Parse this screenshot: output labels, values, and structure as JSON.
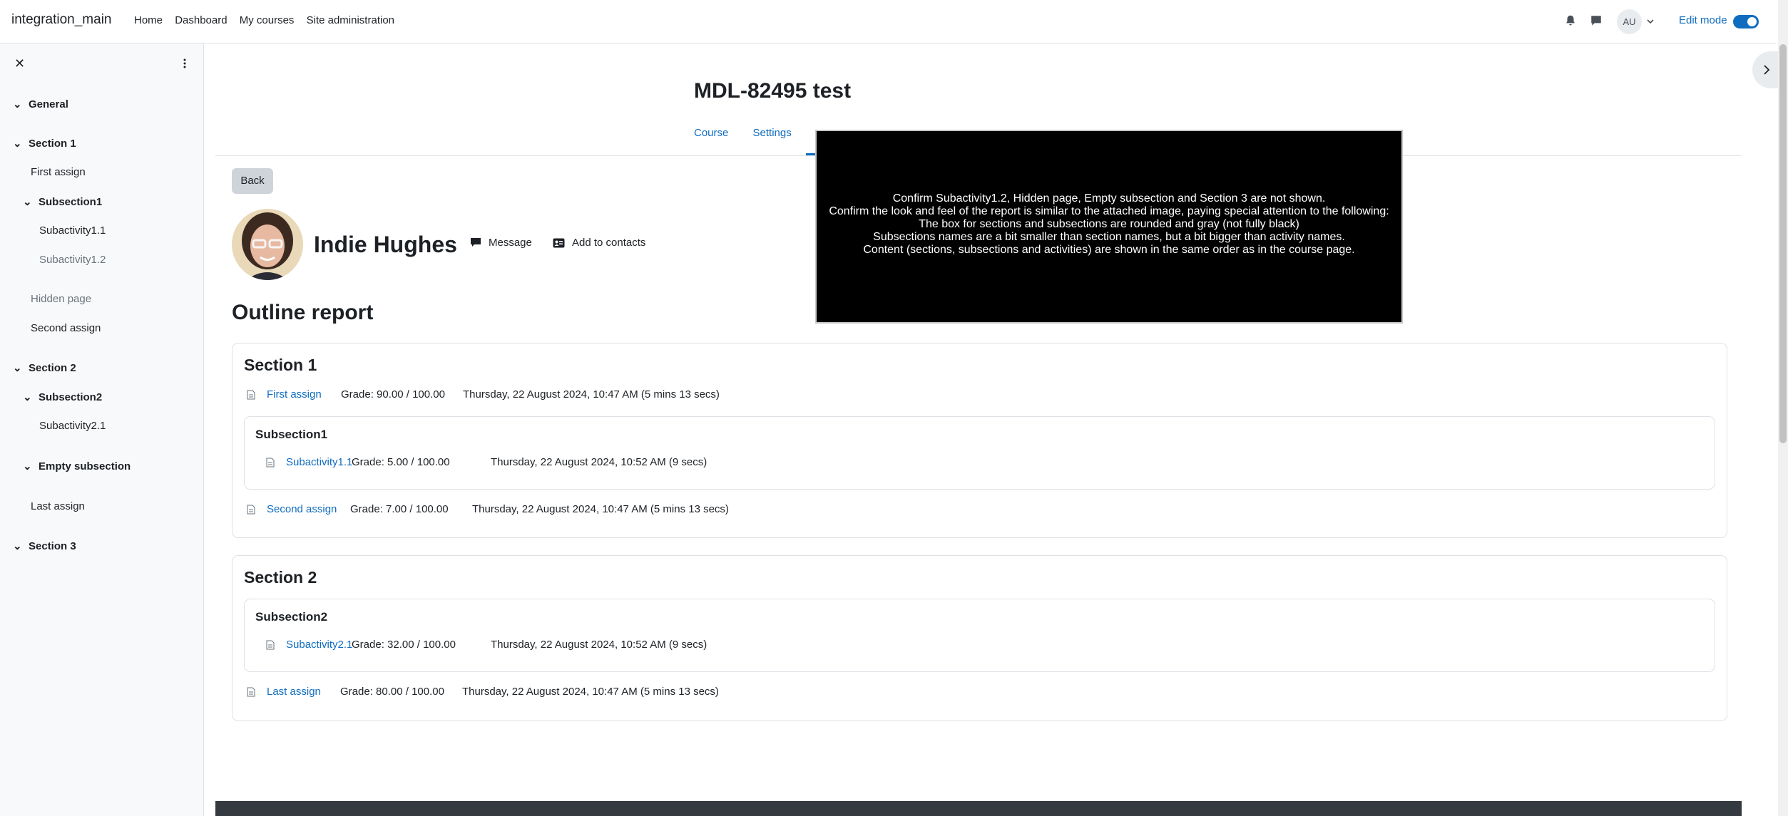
{
  "navbar": {
    "brand": "integration_main",
    "links": [
      "Home",
      "Dashboard",
      "My courses",
      "Site administration"
    ],
    "avatar_initials": "AU",
    "edit_mode_label": "Edit mode"
  },
  "course_index": {
    "items": [
      {
        "label": "General",
        "kind": "section"
      },
      {
        "label": "Section 1",
        "kind": "section"
      },
      {
        "label": "First assign",
        "kind": "activity"
      },
      {
        "label": "Subsection1",
        "kind": "subsection"
      },
      {
        "label": "Subactivity1.1",
        "kind": "subactivity"
      },
      {
        "label": "Subactivity1.2",
        "kind": "subactivity-hidden"
      },
      {
        "label": "Hidden page",
        "kind": "activity-hidden"
      },
      {
        "label": "Second assign",
        "kind": "activity"
      },
      {
        "label": "Section 2",
        "kind": "section"
      },
      {
        "label": "Subsection2",
        "kind": "subsection"
      },
      {
        "label": "Subactivity2.1",
        "kind": "subactivity"
      },
      {
        "label": "Empty subsection",
        "kind": "subsection"
      },
      {
        "label": "Last assign",
        "kind": "activity"
      },
      {
        "label": "Section 3",
        "kind": "section"
      }
    ]
  },
  "course": {
    "title": "MDL-82495 test",
    "tabs": [
      "Course",
      "Settings"
    ]
  },
  "back_button": "Back",
  "user": {
    "name": "Indie Hughes",
    "message_label": "Message",
    "add_contact_label": "Add to contacts"
  },
  "report": {
    "heading": "Outline report",
    "sections": [
      {
        "title": "Section 1",
        "activities": [
          {
            "name": "First assign",
            "grade": "Grade: 90.00 / 100.00",
            "time": "Thursday, 22 August 2024, 10:47 AM (5 mins 13 secs)"
          }
        ],
        "subsection": {
          "title": "Subsection1",
          "activity": {
            "name": "Subactivity1.1",
            "grade": "Grade: 5.00 / 100.00",
            "time": "Thursday, 22 August 2024, 10:52 AM (9 secs)"
          }
        },
        "after": {
          "name": "Second assign",
          "grade": "Grade: 7.00 / 100.00",
          "time": "Thursday, 22 August 2024, 10:47 AM (5 mins 13 secs)"
        }
      },
      {
        "title": "Section 2",
        "subsection": {
          "title": "Subsection2",
          "activity": {
            "name": "Subactivity2.1",
            "grade": "Grade: 32.00 / 100.00",
            "time": "Thursday, 22 August 2024, 10:52 AM (9 secs)"
          }
        },
        "after": {
          "name": "Last assign",
          "grade": "Grade: 80.00 / 100.00",
          "time": "Thursday, 22 August 2024, 10:47 AM (5 mins 13 secs)"
        }
      }
    ]
  },
  "overlay": {
    "lines": [
      "Confirm Subactivity1.2, Hidden page, Empty subsection and Section 3 are not shown.",
      "Confirm the look and feel of the report is similar to the attached image, paying special attention to the following:",
      "The box for sections and subsections are rounded and gray (not fully black)",
      "Subsections names are a bit smaller than section names, but a bit bigger than activity names.",
      "Content (sections, subsections and activities) are shown in the same order as in the course page."
    ]
  },
  "colors": {
    "link": "#0f6cbf",
    "drawer_bg": "#f8f9fa",
    "overlay_bg": "#000000",
    "footer": "#343a40"
  },
  "icons": [
    "bell-icon",
    "chat-icon",
    "chevron-down-icon",
    "close-icon",
    "kebab-icon",
    "chevron-right-icon",
    "message-icon",
    "address-card-icon",
    "assign-icon"
  ]
}
